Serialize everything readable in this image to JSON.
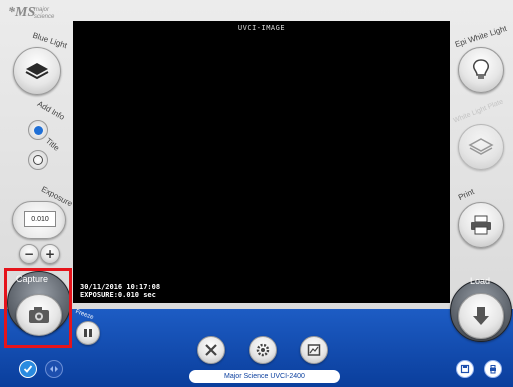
{
  "logo": {
    "mark": "*MS",
    "line1": "major",
    "line2": "science"
  },
  "labels": {
    "blue_light": "Blue Light",
    "add_info": "Add Info",
    "title": "Title",
    "exposure": "Exposure",
    "epi_white_light": "Epi White Light",
    "white_light_plate": "White Light Plate",
    "print": "Print",
    "capture": "Capture",
    "load": "Load",
    "small_left": "Freeze"
  },
  "exposure": {
    "value": "0.010"
  },
  "screen": {
    "title": "UVCI-IMAGE",
    "timestamp": "30/11/2016 10:17:08",
    "exposure_line": "EXPOSURE:0.010 sec"
  },
  "status": {
    "device": "Major Science UVCI-2400"
  },
  "colors": {
    "accent": "#0a3e9c",
    "highlight": "#e5141b",
    "check": "#2a8be0"
  }
}
